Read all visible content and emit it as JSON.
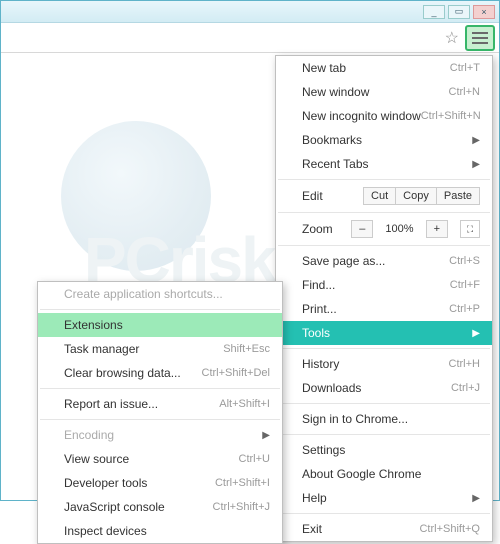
{
  "window": {
    "min": "_",
    "max": "▭",
    "close": "×"
  },
  "main": {
    "newTab": {
      "l": "New tab",
      "s": "Ctrl+T"
    },
    "newWin": {
      "l": "New window",
      "s": "Ctrl+N"
    },
    "incog": {
      "l": "New incognito window",
      "s": "Ctrl+Shift+N"
    },
    "bookmarks": {
      "l": "Bookmarks"
    },
    "recent": {
      "l": "Recent Tabs"
    },
    "edit": {
      "l": "Edit",
      "cut": "Cut",
      "copy": "Copy",
      "paste": "Paste"
    },
    "zoom": {
      "l": "Zoom",
      "minus": "–",
      "val": "100%",
      "plus": "+",
      "fs": "⛶"
    },
    "save": {
      "l": "Save page as...",
      "s": "Ctrl+S"
    },
    "find": {
      "l": "Find...",
      "s": "Ctrl+F"
    },
    "print": {
      "l": "Print...",
      "s": "Ctrl+P"
    },
    "tools": {
      "l": "Tools"
    },
    "history": {
      "l": "History",
      "s": "Ctrl+H"
    },
    "downloads": {
      "l": "Downloads",
      "s": "Ctrl+J"
    },
    "signin": {
      "l": "Sign in to Chrome..."
    },
    "settings": {
      "l": "Settings"
    },
    "about": {
      "l": "About Google Chrome"
    },
    "help": {
      "l": "Help"
    },
    "exit": {
      "l": "Exit",
      "s": "Ctrl+Shift+Q"
    }
  },
  "sub": {
    "shortcuts": {
      "l": "Create application shortcuts..."
    },
    "ext": {
      "l": "Extensions"
    },
    "task": {
      "l": "Task manager",
      "s": "Shift+Esc"
    },
    "clear": {
      "l": "Clear browsing data...",
      "s": "Ctrl+Shift+Del"
    },
    "report": {
      "l": "Report an issue...",
      "s": "Alt+Shift+I"
    },
    "encoding": {
      "l": "Encoding"
    },
    "source": {
      "l": "View source",
      "s": "Ctrl+U"
    },
    "devtools": {
      "l": "Developer tools",
      "s": "Ctrl+Shift+I"
    },
    "js": {
      "l": "JavaScript console",
      "s": "Ctrl+Shift+J"
    },
    "inspect": {
      "l": "Inspect devices"
    }
  },
  "watermark": "PCrisk.com"
}
